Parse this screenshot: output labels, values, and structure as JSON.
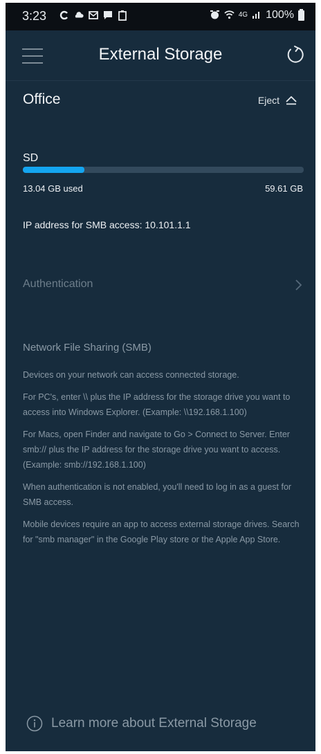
{
  "status_bar": {
    "time": "3:23",
    "left_icons": [
      "c-icon",
      "cloud-icon",
      "mail-icon",
      "chat-icon",
      "clipboard-icon"
    ],
    "network_label": "4G",
    "battery_text": "100%"
  },
  "header": {
    "title": "External Storage"
  },
  "device": {
    "name": "Office",
    "eject_label": "Eject"
  },
  "storage": {
    "drive_label": "SD",
    "used_label": "13.04 GB used",
    "total_label": "59.61 GB",
    "used_fraction": 0.2188
  },
  "ip_line": "IP address for SMB access: 10.101.1.1",
  "authentication": {
    "label": "Authentication"
  },
  "smb": {
    "heading": "Network File Sharing (SMB)",
    "paragraphs": [
      "Devices on your network can access connected storage.",
      "For PC's, enter \\\\ plus the IP address for the storage drive you want to access into Windows Explorer. (Example: \\\\192.168.1.100)",
      "For Macs, open Finder and navigate to Go > Connect to Server. Enter smb:// plus the IP address for the storage drive you want to access. (Example: smb://192.168.1.100)",
      "When authentication is not enabled, you'll need to log in as a guest for SMB access.",
      "Mobile devices require an app to access external storage drives. Search for \"smb manager\" in the Google Play store or the Apple App Store."
    ]
  },
  "footer": {
    "learn_more": "Learn more about External Storage"
  },
  "colors": {
    "background": "#172c3d",
    "accent": "#14a5f0",
    "muted_text": "#8a99a5"
  }
}
